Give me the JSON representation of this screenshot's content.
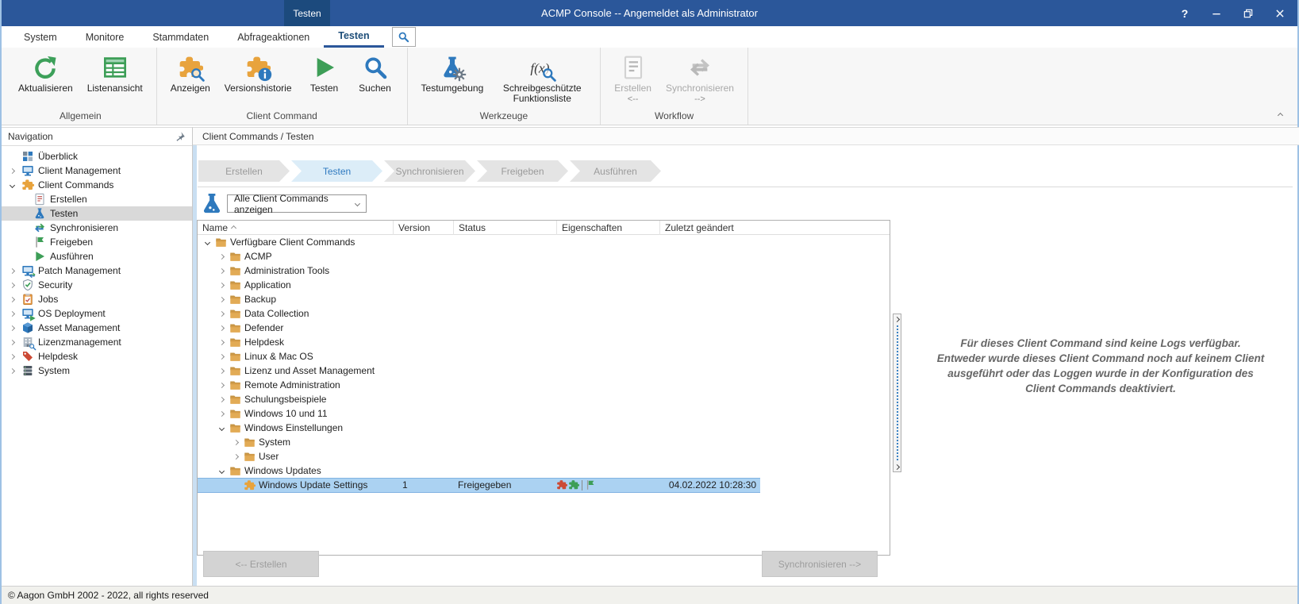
{
  "colors": {
    "title_bar": "#2b579a",
    "title_tab": "#1c4a7d",
    "accent_blue": "#2e79bd",
    "selection_blue": "#abd2f2",
    "nav_selected_gray": "#d9d9d9",
    "step_active_bg": "#dcedf8",
    "step_active_text": "#2f7ac0",
    "icon_orange": "#e8a33d",
    "icon_green": "#3d9e57",
    "icon_red": "#cc4a35"
  },
  "window": {
    "title": "ACMP Console -- Angemeldet als Administrator",
    "tab": "Testen",
    "controls": {
      "help": "?",
      "minimize": "minimize",
      "restore": "restore",
      "close": "close"
    }
  },
  "menu": {
    "items": [
      "System",
      "Monitore",
      "Stammdaten",
      "Abfrageaktionen",
      "Testen"
    ],
    "active": "Testen",
    "search_icon": "search-icon"
  },
  "ribbon": {
    "groups": [
      {
        "label": "Allgemein",
        "buttons": [
          {
            "label": "Aktualisieren",
            "icon": "refresh",
            "color": "#3da05a"
          },
          {
            "label": "Listenansicht",
            "icon": "list",
            "color": "#3d9e57"
          }
        ]
      },
      {
        "label": "Client Command",
        "buttons": [
          {
            "label": "Anzeigen",
            "icon": "puzzle",
            "color": "#e8a33d",
            "badge": "search",
            "badge_color": "#2e79bd"
          },
          {
            "label": "Versionshistorie",
            "icon": "puzzle",
            "color": "#e8a33d",
            "badge": "info"
          },
          {
            "label": "Testen",
            "icon": "play",
            "color": "#3d9e57"
          },
          {
            "label": "Suchen",
            "icon": "search",
            "color": "#2e79bd"
          }
        ]
      },
      {
        "label": "Werkzeuge",
        "buttons": [
          {
            "label": "Testumgebung",
            "icon": "flask",
            "color": "#2e79bd",
            "badge": "gear"
          },
          {
            "label": "Schreibgeschützte Funktionsliste",
            "icon": "fx",
            "badge": "search",
            "badge_color": "#2e79bd"
          }
        ]
      },
      {
        "label": "Workflow",
        "buttons": [
          {
            "label": "Erstellen",
            "sub": "<--",
            "icon": "doc",
            "disabled": true
          },
          {
            "label": "Synchronisieren",
            "sub": "-->",
            "icon": "sync",
            "disabled": true
          }
        ]
      }
    ]
  },
  "nav": {
    "header": "Navigation",
    "pin_icon": "pin-icon",
    "items": [
      {
        "label": "Überblick",
        "icon": "grid",
        "depth": 0,
        "expander": "none"
      },
      {
        "label": "Client Management",
        "icon": "monitor",
        "color": "#2e79bd",
        "depth": 0,
        "expander": "collapsed"
      },
      {
        "label": "Client Commands",
        "icon": "puzzle",
        "color": "#e8a33d",
        "depth": 0,
        "expander": "expanded"
      },
      {
        "label": "Erstellen",
        "icon": "doc",
        "depth": 1
      },
      {
        "label": "Testen",
        "icon": "flask",
        "color": "#2e79bd",
        "depth": 1,
        "selected": true
      },
      {
        "label": "Synchronisieren",
        "icon": "sync",
        "depth": 1
      },
      {
        "label": "Freigeben",
        "icon": "flag",
        "color": "#3d9e57",
        "depth": 1
      },
      {
        "label": "Ausführen",
        "icon": "play",
        "color": "#3d9e57",
        "depth": 1
      },
      {
        "label": "Patch Management",
        "icon": "monitor",
        "color": "#2e79bd",
        "badge": "sync",
        "depth": 0,
        "expander": "collapsed"
      },
      {
        "label": "Security",
        "icon": "shield",
        "depth": 0,
        "expander": "collapsed"
      },
      {
        "label": "Jobs",
        "icon": "clip",
        "depth": 0,
        "expander": "collapsed"
      },
      {
        "label": "OS Deployment",
        "icon": "monitor",
        "color": "#2e79bd",
        "badge": "play",
        "badge_color": "#3d9e57",
        "depth": 0,
        "expander": "collapsed"
      },
      {
        "label": "Asset Management",
        "icon": "pkg",
        "depth": 0,
        "expander": "collapsed"
      },
      {
        "label": "Lizenzmanagement",
        "icon": "lic",
        "badge": "search",
        "badge_color": "#2e79bd",
        "depth": 0,
        "expander": "collapsed"
      },
      {
        "label": "Helpdesk",
        "icon": "tag",
        "color": "#cc4a35",
        "depth": 0,
        "expander": "collapsed"
      },
      {
        "label": "System",
        "icon": "server",
        "depth": 0,
        "expander": "collapsed"
      }
    ]
  },
  "breadcrumb": "Client Commands / Testen",
  "workflow_steps": [
    {
      "label": "Erstellen"
    },
    {
      "label": "Testen",
      "active": true
    },
    {
      "label": "Synchronisieren"
    },
    {
      "label": "Freigeben"
    },
    {
      "label": "Ausführen"
    }
  ],
  "filter": {
    "value": "Alle Client Commands anzeigen",
    "flask_icon": "flask-icon"
  },
  "table": {
    "columns": [
      "Name",
      "Version",
      "Status",
      "Eigenschaften",
      "Zuletzt geändert"
    ],
    "sort_column": "Name",
    "sort_direction": "asc",
    "rows": [
      {
        "depth": 0,
        "expander": "expanded",
        "icon": "folder",
        "name": "Verfügbare Client Commands"
      },
      {
        "depth": 1,
        "expander": "collapsed",
        "icon": "folder",
        "name": "ACMP"
      },
      {
        "depth": 1,
        "expander": "collapsed",
        "icon": "folder",
        "name": "Administration Tools"
      },
      {
        "depth": 1,
        "expander": "collapsed",
        "icon": "folder",
        "name": "Application"
      },
      {
        "depth": 1,
        "expander": "collapsed",
        "icon": "folder",
        "name": "Backup"
      },
      {
        "depth": 1,
        "expander": "collapsed",
        "icon": "folder",
        "name": "Data Collection"
      },
      {
        "depth": 1,
        "expander": "collapsed",
        "icon": "folder",
        "name": "Defender"
      },
      {
        "depth": 1,
        "expander": "collapsed",
        "icon": "folder",
        "name": "Helpdesk"
      },
      {
        "depth": 1,
        "expander": "collapsed",
        "icon": "folder",
        "name": "Linux & Mac OS"
      },
      {
        "depth": 1,
        "expander": "collapsed",
        "icon": "folder",
        "name": "Lizenz und Asset Management"
      },
      {
        "depth": 1,
        "expander": "collapsed",
        "icon": "folder",
        "name": "Remote Administration"
      },
      {
        "depth": 1,
        "expander": "collapsed",
        "icon": "folder",
        "name": "Schulungsbeispiele"
      },
      {
        "depth": 1,
        "expander": "collapsed",
        "icon": "folder",
        "name": "Windows 10 und 11"
      },
      {
        "depth": 1,
        "expander": "expanded",
        "icon": "folder",
        "name": "Windows Einstellungen"
      },
      {
        "depth": 2,
        "expander": "collapsed",
        "icon": "folder",
        "name": "System"
      },
      {
        "depth": 2,
        "expander": "collapsed",
        "icon": "folder",
        "name": "User"
      },
      {
        "depth": 1,
        "expander": "expanded",
        "icon": "folder",
        "name": "Windows Updates"
      },
      {
        "depth": 2,
        "expander": "none",
        "icon": "puzzle",
        "name": "Windows Update Settings",
        "version": "1",
        "status": "Freigegeben",
        "properties": [
          "red-puzzle-icon",
          "green-puzzle-icon",
          "green-flag-icon"
        ],
        "modified": "04.02.2022 10:28:30",
        "selected": true
      }
    ]
  },
  "log_message": {
    "lines": [
      "Für dieses Client Command sind keine Logs verfügbar.",
      "Entweder wurde dieses Client Command noch auf keinem Client",
      "ausgeführt oder das Loggen wurde in der Konfiguration des",
      "Client Commands deaktiviert."
    ]
  },
  "footer": {
    "create_label": "<-- Erstellen",
    "sync_label": "Synchronisieren -->"
  },
  "statusbar": {
    "text": "© Aagon GmbH 2002 - 2022, all rights reserved"
  }
}
